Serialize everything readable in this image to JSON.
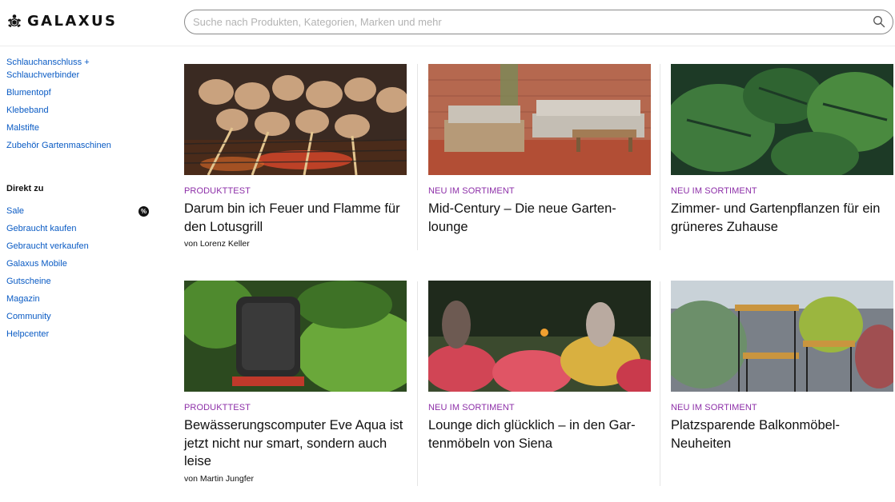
{
  "brand": {
    "name": "GALAXUS"
  },
  "search": {
    "placeholder": "Suche nach Produkten, Kategorien, Marken und mehr"
  },
  "sidebar": {
    "categories": [
      "Schlauchanschluss + Schlauchverbinder",
      "Blumentopf",
      "Klebeband",
      "Malstifte",
      "Zubehör Gartenmaschinen"
    ],
    "direct_heading": "Direkt zu",
    "direct_links": [
      "Sale",
      "Gebraucht kaufen",
      "Gebraucht verkaufen",
      "Galaxus Mobile",
      "Gutscheine",
      "Magazin",
      "Community",
      "Helpcenter"
    ],
    "sale_badge": "%"
  },
  "articles": [
    {
      "tag": "PRODUKTTEST",
      "title": "Darum bin ich Feuer und Flamme für den Lotusgrill",
      "author": "von Lorenz Keller"
    },
    {
      "tag": "NEU IM SORTIMENT",
      "title": "Mid-Century – Die neue Garten-lounge",
      "author": ""
    },
    {
      "tag": "NEU IM SORTIMENT",
      "title": "Zimmer- und Gartenpflanzen für ein grüneres Zuhause",
      "author": ""
    },
    {
      "tag": "PRODUKTTEST",
      "title": "Bewässerungscomputer Eve Aqua ist jetzt nicht nur smart, sondern auch leise",
      "author": "von Martin Jungfer"
    },
    {
      "tag": "NEU IM SORTIMENT",
      "title": "Lounge dich glücklich – in den Gar-tenmöbeln von Siena",
      "author": ""
    },
    {
      "tag": "NEU IM SORTIMENT",
      "title": "Platzsparende Balkonmöbel-Neuheiten",
      "author": ""
    }
  ],
  "icons": {
    "logo": "turtle-logo-icon",
    "search": "search-icon"
  },
  "colors": {
    "link": "#0a5bc4",
    "tag": "#8d2fa8",
    "text": "#111111"
  }
}
